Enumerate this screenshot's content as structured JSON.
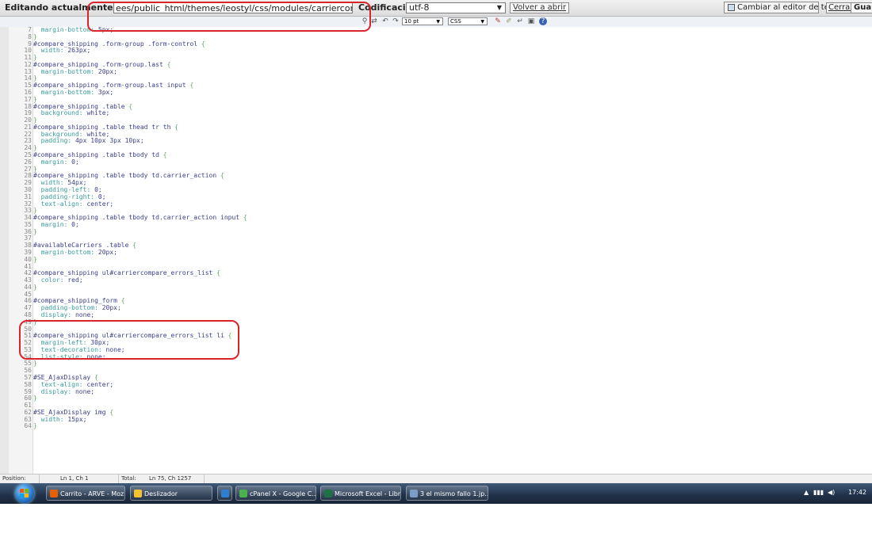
{
  "topbar": {
    "editing_label": "Editando actualmente :",
    "file_path": "ees/public_html/themes/leostyl/css/modules/carriercompare/style.css",
    "encoding_label": "Codificación:",
    "encoding_value": "utf-8",
    "reopen_label": "Volver a abrir",
    "switch_editor_label": "Cambiar al editor de texto",
    "close_label": "Cerrar",
    "save_label": "Guardar"
  },
  "toolbar": {
    "font_size": "10 pt",
    "syntax": "CSS",
    "icons": [
      "search-icon",
      "replace-icon",
      "undo-icon",
      "redo-icon",
      "highlight-icon",
      "reset-icon",
      "wrap-icon",
      "fullscreen-icon",
      "help-icon"
    ]
  },
  "code": {
    "lines": [
      {
        "n": "7",
        "text": "  margin-bottom: 5px;"
      },
      {
        "n": "8",
        "text": "}"
      },
      {
        "n": "9",
        "text": "#compare_shipping .form-group .form-control {"
      },
      {
        "n": "10",
        "text": "  width: 263px;"
      },
      {
        "n": "11",
        "text": "}"
      },
      {
        "n": "12",
        "text": "#compare_shipping .form-group.last {"
      },
      {
        "n": "13",
        "text": "  margin-bottom: 20px;"
      },
      {
        "n": "14",
        "text": "}"
      },
      {
        "n": "15",
        "text": "#compare_shipping .form-group.last input {"
      },
      {
        "n": "16",
        "text": "  margin-bottom: 3px;"
      },
      {
        "n": "17",
        "text": "}"
      },
      {
        "n": "18",
        "text": "#compare_shipping .table {"
      },
      {
        "n": "19",
        "text": "  background: white;"
      },
      {
        "n": "20",
        "text": "}"
      },
      {
        "n": "21",
        "text": "#compare_shipping .table thead tr th {"
      },
      {
        "n": "22",
        "text": "  background: white;"
      },
      {
        "n": "23",
        "text": "  padding: 4px 10px 3px 10px;"
      },
      {
        "n": "24",
        "text": "}"
      },
      {
        "n": "25",
        "text": "#compare_shipping .table tbody td {"
      },
      {
        "n": "26",
        "text": "  margin: 0;"
      },
      {
        "n": "27",
        "text": "}"
      },
      {
        "n": "28",
        "text": "#compare_shipping .table tbody td.carrier_action {"
      },
      {
        "n": "29",
        "text": "  width: 54px;"
      },
      {
        "n": "30",
        "text": "  padding-left: 0;"
      },
      {
        "n": "31",
        "text": "  padding-right: 0;"
      },
      {
        "n": "32",
        "text": "  text-align: center;"
      },
      {
        "n": "33",
        "text": "}"
      },
      {
        "n": "34",
        "text": "#compare_shipping .table tbody td.carrier_action input {"
      },
      {
        "n": "35",
        "text": "  margin: 0;"
      },
      {
        "n": "36",
        "text": "}"
      },
      {
        "n": "37",
        "text": ""
      },
      {
        "n": "38",
        "text": "#availableCarriers .table {"
      },
      {
        "n": "39",
        "text": "  margin-bottom: 20px;"
      },
      {
        "n": "40",
        "text": "}"
      },
      {
        "n": "41",
        "text": ""
      },
      {
        "n": "42",
        "text": "#compare_shipping ul#carriercompare_errors_list {"
      },
      {
        "n": "43",
        "text": "  color: red;"
      },
      {
        "n": "44",
        "text": "}"
      },
      {
        "n": "45",
        "text": ""
      },
      {
        "n": "46",
        "text": "#compare_shipping_form {"
      },
      {
        "n": "47",
        "text": "  padding-bottom: 20px;"
      },
      {
        "n": "48",
        "text": "  display: none;"
      },
      {
        "n": "49",
        "text": "}"
      },
      {
        "n": "50",
        "text": ""
      },
      {
        "n": "51",
        "text": "#compare_shipping ul#carriercompare_errors_list li {"
      },
      {
        "n": "52",
        "text": "  margin-left: 30px;"
      },
      {
        "n": "53",
        "text": "  text-decoration: none;"
      },
      {
        "n": "54",
        "text": "  list-style: none;"
      },
      {
        "n": "55",
        "text": "}"
      },
      {
        "n": "56",
        "text": ""
      },
      {
        "n": "57",
        "text": "#SE_AjaxDisplay {"
      },
      {
        "n": "58",
        "text": "  text-align: center;"
      },
      {
        "n": "59",
        "text": "  display: none;"
      },
      {
        "n": "60",
        "text": "}"
      },
      {
        "n": "61",
        "text": ""
      },
      {
        "n": "62",
        "text": "#SE_AjaxDisplay img {"
      },
      {
        "n": "63",
        "text": "  width: 15px;"
      },
      {
        "n": "64",
        "text": "}"
      }
    ]
  },
  "statusbar": {
    "position_label": "Position:",
    "position_value": "Ln 1, Ch 1",
    "total_label": "Total:",
    "total_value": "Ln 75, Ch 1257"
  },
  "taskbar": {
    "tasks": [
      {
        "label": "Carrito - ARVE - Moz...",
        "icon_color": "#e66000"
      },
      {
        "label": "Deslizador",
        "icon_color": "#f2c230"
      },
      {
        "label": "",
        "icon_color": "#2f7fd0"
      },
      {
        "label": "cPanel X - Google C...",
        "icon_color": "#4caf50"
      },
      {
        "label": "Microsoft Excel - Libr...",
        "icon_color": "#1e7145"
      },
      {
        "label": "3 el mismo fallo 1.jp...",
        "icon_color": "#7a9cc6"
      }
    ],
    "clock": "17:42"
  },
  "colors": {
    "annotation_red": "#d9242c",
    "selector": "#3b3f8c",
    "property": "#3a9b9b",
    "brace": "#6aa66a"
  }
}
